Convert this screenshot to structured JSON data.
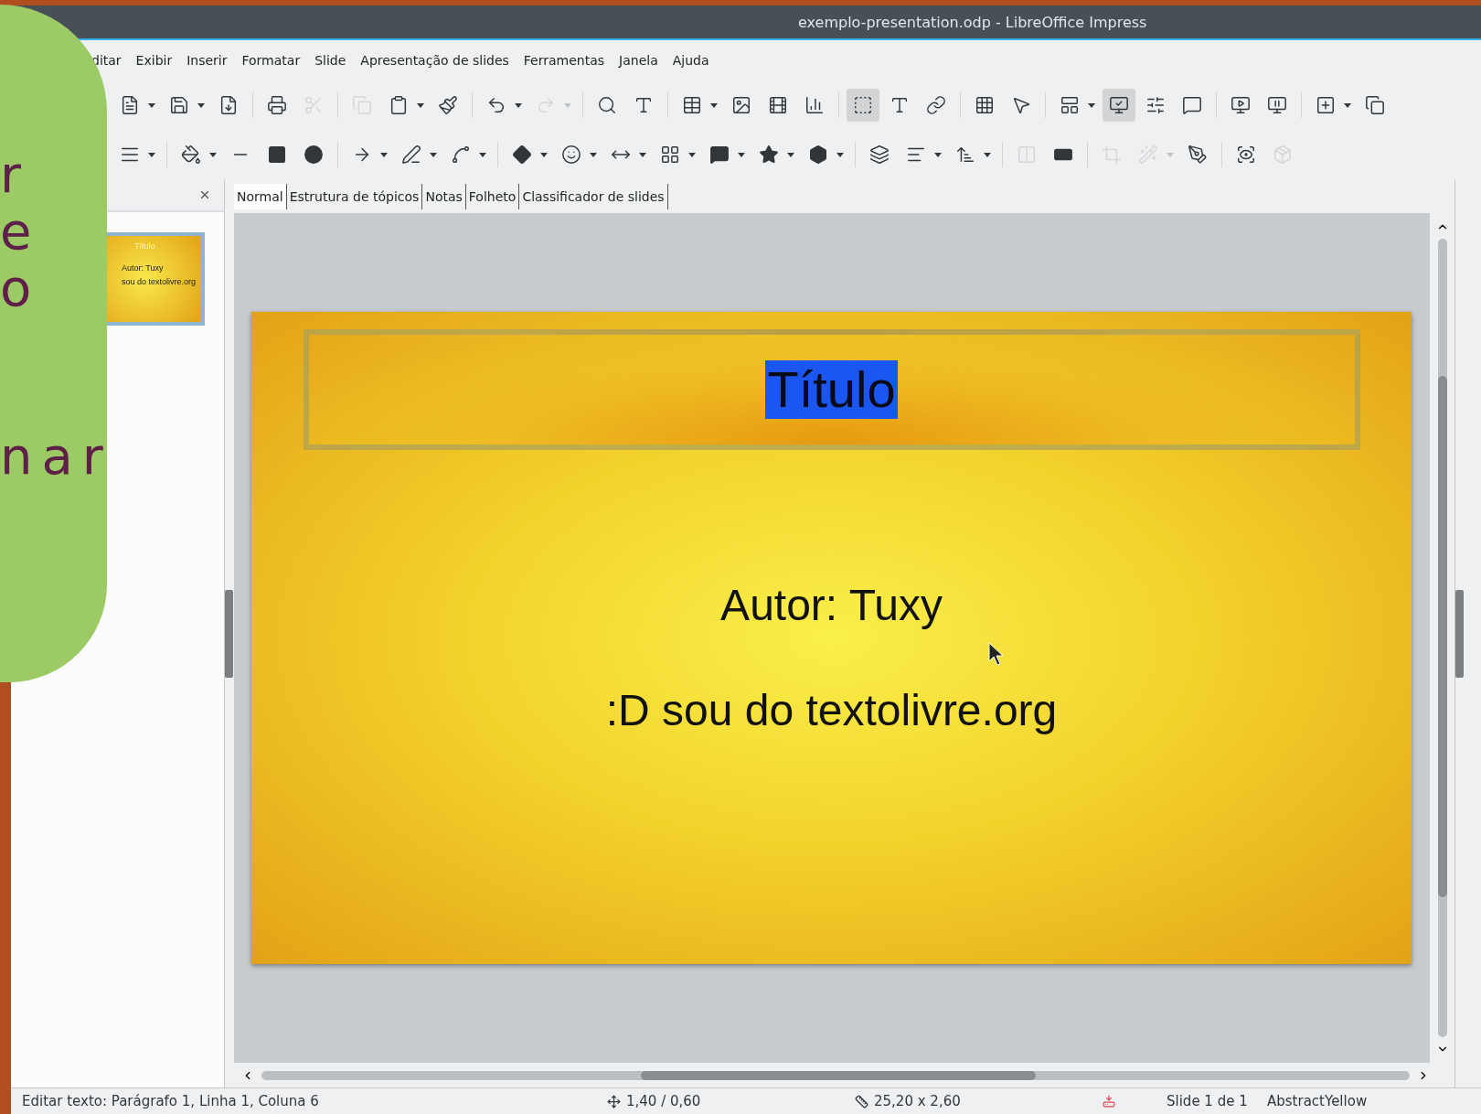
{
  "window": {
    "title": "exemplo-presentation.odp - LibreOffice Impress"
  },
  "menu": [
    "ditar",
    "Exibir",
    "Inserir",
    "Formatar",
    "Slide",
    "Apresentação de slides",
    "Ferramentas",
    "Janela",
    "Ajuda"
  ],
  "toolbar_1": [
    {
      "dropdown": true,
      "pressed": false,
      "disabled": false
    },
    {
      "dropdown": true,
      "pressed": false,
      "disabled": false
    },
    {
      "dropdown": false,
      "pressed": false,
      "disabled": false
    },
    {
      "dropdown": false,
      "pressed": false,
      "disabled": false
    },
    {
      "dropdown": false,
      "pressed": false,
      "disabled": true
    },
    {
      "dropdown": false,
      "pressed": false,
      "disabled": true
    },
    {
      "dropdown": true,
      "pressed": false,
      "disabled": false
    },
    {
      "dropdown": false,
      "pressed": false,
      "disabled": false
    },
    {
      "dropdown": true,
      "pressed": false,
      "disabled": false
    },
    {
      "dropdown": true,
      "pressed": false,
      "disabled": true
    },
    {
      "dropdown": false,
      "pressed": false,
      "disabled": false
    },
    {
      "dropdown": false,
      "pressed": false,
      "disabled": false
    },
    {
      "dropdown": true,
      "pressed": false,
      "disabled": false
    },
    {
      "dropdown": false,
      "pressed": false,
      "disabled": false
    },
    {
      "dropdown": false,
      "pressed": false,
      "disabled": false
    },
    {
      "dropdown": false,
      "pressed": false,
      "disabled": false
    },
    {
      "dropdown": false,
      "pressed": true,
      "disabled": false
    },
    {
      "dropdown": false,
      "pressed": false,
      "disabled": false
    },
    {
      "dropdown": false,
      "pressed": false,
      "disabled": false
    },
    {
      "dropdown": false,
      "pressed": false,
      "disabled": false
    },
    {
      "dropdown": false,
      "pressed": false,
      "disabled": false
    },
    {
      "dropdown": true,
      "pressed": false,
      "disabled": false
    },
    {
      "dropdown": false,
      "pressed": true,
      "disabled": false
    },
    {
      "dropdown": false,
      "pressed": false,
      "disabled": false
    },
    {
      "dropdown": false,
      "pressed": false,
      "disabled": false
    },
    {
      "dropdown": false,
      "pressed": false,
      "disabled": false
    },
    {
      "dropdown": false,
      "pressed": false,
      "disabled": false
    },
    {
      "dropdown": true,
      "pressed": false,
      "disabled": false
    },
    {
      "dropdown": false,
      "pressed": false,
      "disabled": false
    }
  ],
  "toolbar_2": [
    {
      "dropdown": true,
      "disabled": false
    },
    {
      "dropdown": true,
      "disabled": false
    },
    {
      "dropdown": false,
      "disabled": false
    },
    {
      "dropdown": false,
      "disabled": false
    },
    {
      "dropdown": false,
      "disabled": false
    },
    {
      "dropdown": true,
      "disabled": false
    },
    {
      "dropdown": true,
      "disabled": false
    },
    {
      "dropdown": true,
      "disabled": false
    },
    {
      "dropdown": true,
      "disabled": false
    },
    {
      "dropdown": true,
      "disabled": false
    },
    {
      "dropdown": true,
      "disabled": false
    },
    {
      "dropdown": true,
      "disabled": false
    },
    {
      "dropdown": true,
      "disabled": false
    },
    {
      "dropdown": true,
      "disabled": false
    },
    {
      "dropdown": true,
      "disabled": false
    },
    {
      "dropdown": false,
      "disabled": false
    },
    {
      "dropdown": true,
      "disabled": false
    },
    {
      "dropdown": true,
      "disabled": false
    },
    {
      "dropdown": false,
      "disabled": true
    },
    {
      "dropdown": false,
      "disabled": false
    },
    {
      "dropdown": false,
      "disabled": true
    },
    {
      "dropdown": true,
      "disabled": true
    },
    {
      "dropdown": false,
      "disabled": false
    },
    {
      "dropdown": false,
      "disabled": false
    },
    {
      "dropdown": false,
      "disabled": true
    }
  ],
  "view_tabs": [
    {
      "label": "Normal",
      "selected": true
    },
    {
      "label": "Estrutura de tópicos",
      "selected": false
    },
    {
      "label": "Notas",
      "selected": false
    },
    {
      "label": "Folheto",
      "selected": false
    },
    {
      "label": "Classificador de slides",
      "selected": false
    }
  ],
  "slide_thumbnail": {
    "title": "Título",
    "lines": [
      "Autor: Tuxy",
      "sou do textolivre.org"
    ]
  },
  "slide": {
    "title": "Título",
    "lines": [
      "Autor: Tuxy",
      ":D sou do textolivre.org"
    ]
  },
  "status_bar": {
    "mode": "Editar texto: Parágrafo 1, Linha 1, Coluna 6",
    "position": "1,40 / 0,60",
    "size": "25,20 x 2,60",
    "slide": "Slide 1 de 1",
    "design": "AbstractYellow"
  },
  "overlay": {
    "letters": [
      "r",
      "e",
      "o",
      "nar"
    ]
  }
}
